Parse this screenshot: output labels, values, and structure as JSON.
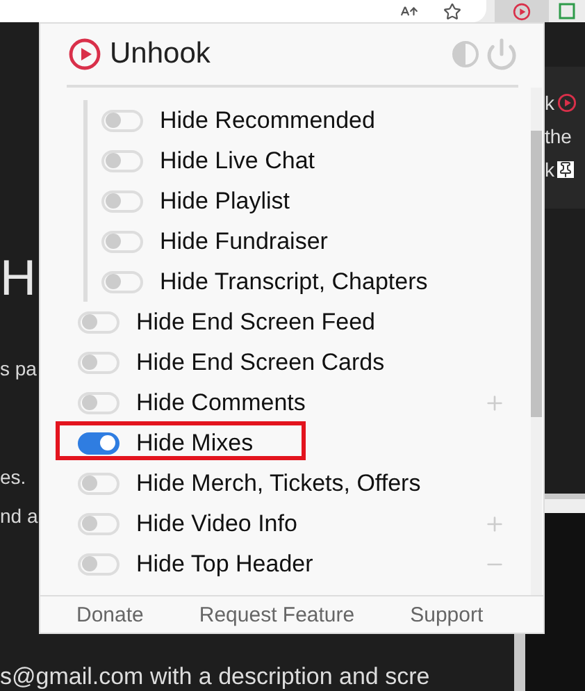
{
  "browser_toolbar": {
    "extension_active": true
  },
  "page": {
    "left_fragments": [
      "H",
      "s pa",
      "es.",
      "nd a"
    ],
    "right_fragments": [
      {
        "kind": "play",
        "text": "k"
      },
      {
        "kind": "text",
        "text": "the"
      },
      {
        "kind": "pin",
        "text": "k"
      }
    ],
    "bottom_line": "s@gmail.com with a description and scre"
  },
  "popup": {
    "title": "Unhook",
    "options": [
      {
        "kind": "group",
        "children": [
          {
            "label": "Hide Recommended",
            "on": false
          },
          {
            "label": "Hide Live Chat",
            "on": false
          },
          {
            "label": "Hide Playlist",
            "on": false
          },
          {
            "label": "Hide Fundraiser",
            "on": false
          },
          {
            "label": "Hide Transcript, Chapters",
            "on": false
          }
        ]
      },
      {
        "kind": "toggle",
        "label": "Hide End Screen Feed",
        "on": false
      },
      {
        "kind": "toggle",
        "label": "Hide End Screen Cards",
        "on": false
      },
      {
        "kind": "expandable",
        "label": "Hide Comments",
        "on": false,
        "expanded": false
      },
      {
        "kind": "toggle",
        "label": "Hide Mixes",
        "on": true,
        "highlighted": true
      },
      {
        "kind": "toggle",
        "label": "Hide Merch, Tickets, Offers",
        "on": false
      },
      {
        "kind": "expandable",
        "label": "Hide Video Info",
        "on": false,
        "expanded": false
      },
      {
        "kind": "expandable",
        "label": "Hide Top Header",
        "on": false,
        "expanded": true
      }
    ],
    "footer_links": [
      "Donate",
      "Request Feature",
      "Support"
    ]
  }
}
